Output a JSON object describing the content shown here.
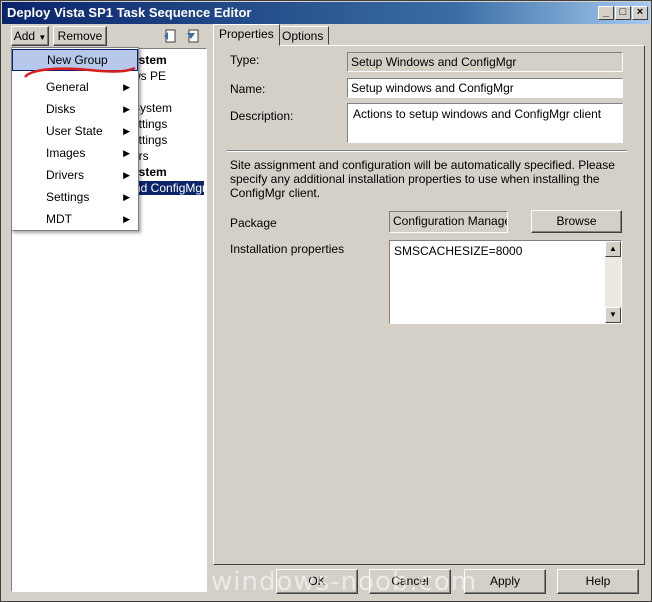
{
  "window": {
    "title": "Deploy Vista SP1 Task Sequence Editor"
  },
  "toolbar": {
    "add_label": "Add",
    "remove_label": "Remove"
  },
  "tree": {
    "items": [
      {
        "text": "ystem",
        "bold": true
      },
      {
        "text": "ws PE",
        "bold": false
      },
      {
        "text": "",
        "bold": false
      },
      {
        "text": "System",
        "bold": false
      },
      {
        "text": "ettings",
        "bold": false
      },
      {
        "text": "ettings",
        "bold": false
      },
      {
        "text": "ers",
        "bold": false
      },
      {
        "text": "ystem",
        "bold": true
      },
      {
        "text": "nd ConfigMgr",
        "bold": false,
        "selected": true
      }
    ]
  },
  "add_menu": {
    "items": [
      {
        "label": "New Group",
        "submenu": false,
        "highlighted": true
      },
      {
        "label": "General",
        "submenu": true
      },
      {
        "label": "Disks",
        "submenu": true
      },
      {
        "label": "User State",
        "submenu": true
      },
      {
        "label": "Images",
        "submenu": true
      },
      {
        "label": "Drivers",
        "submenu": true
      },
      {
        "label": "Settings",
        "submenu": true
      },
      {
        "label": "MDT",
        "submenu": true
      }
    ]
  },
  "tabs": [
    {
      "label": "Properties"
    },
    {
      "label": "Options"
    }
  ],
  "properties": {
    "type_label": "Type:",
    "type_value": "Setup Windows and ConfigMgr",
    "name_label": "Name:",
    "name_value": "Setup windows and ConfigMgr",
    "description_label": "Description:",
    "description_value": "Actions to setup windows and ConfigMgr client",
    "info_text": "Site assignment and configuration will be automatically specified. Please specify any additional installation properties to use when installing the ConfigMgr client.",
    "package_label": "Package",
    "package_value": "Configuration Manager C",
    "browse_label": "Browse",
    "install_props_label": "Installation properties",
    "install_props_value": "SMSCACHESIZE=8000"
  },
  "footer": {
    "ok_label": "OK",
    "cancel_label": "Cancel",
    "apply_label": "Apply",
    "help_label": "Help"
  },
  "watermark": "windows-noob.com",
  "colors": {
    "title_bar": "#0a246a",
    "selection": "#0a246a",
    "menu_highlight": "#b6c9ea",
    "annotation": "#d81e1e"
  }
}
